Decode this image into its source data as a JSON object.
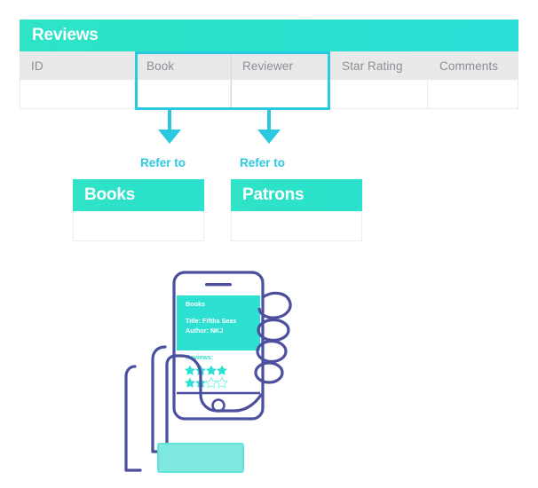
{
  "table": {
    "title": "Reviews",
    "columns": [
      {
        "key": "id",
        "label": "ID",
        "highlighted": false
      },
      {
        "key": "book",
        "label": "Book",
        "highlighted": true
      },
      {
        "key": "reviewer",
        "label": "Reviewer",
        "highlighted": true
      },
      {
        "key": "star_rating",
        "label": "Star Rating",
        "highlighted": false
      },
      {
        "key": "comments",
        "label": "Comments",
        "highlighted": false
      }
    ],
    "rows": [
      {
        "id": "",
        "book": "",
        "reviewer": "",
        "star_rating": "",
        "comments": ""
      }
    ]
  },
  "relations": [
    {
      "from_column": "Book",
      "label": "Refer to",
      "to_entity": "Books"
    },
    {
      "from_column": "Reviewer",
      "label": "Refer to",
      "to_entity": "Patrons"
    }
  ],
  "entities": [
    {
      "name": "Books"
    },
    {
      "name": "Patrons"
    }
  ],
  "illustration": {
    "name": "hand-holding-phone",
    "phone_screen": {
      "app_title": "Books",
      "title_line": "Title: Fifths Seas",
      "author_line": "Author: NKJ",
      "reviews_label": "Reviews:",
      "rating_rows": [
        {
          "filled": 4,
          "empty": 0
        },
        {
          "filled": 2,
          "empty": 2
        }
      ]
    }
  },
  "colors": {
    "teal": "#2ee3c6",
    "cyan": "#2bc9e0",
    "header_text": "#ffffff",
    "table_header_bg": "#e9e9e9",
    "table_header_text": "#8b8f95",
    "outline_navy": "#4b4f9e",
    "star_teal": "#2ee0d2",
    "base_bar": "#7fe9df"
  }
}
